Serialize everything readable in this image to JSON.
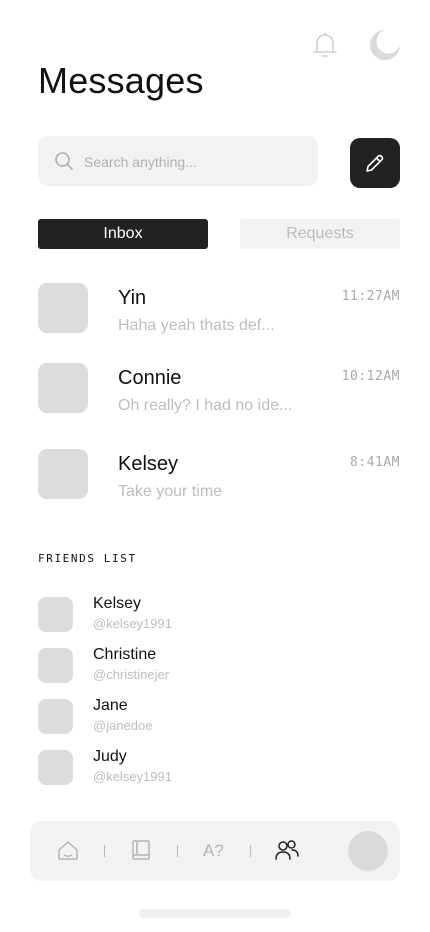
{
  "header": {
    "title": "Messages",
    "icons": [
      "bell-icon",
      "moon-icon"
    ]
  },
  "search": {
    "placeholder": "Search anything...",
    "value": ""
  },
  "tabs": [
    {
      "label": "Inbox",
      "active": true
    },
    {
      "label": "Requests",
      "active": false
    }
  ],
  "conversations": [
    {
      "name": "Yin",
      "preview": "Haha yeah thats def...",
      "time": "11:27AM"
    },
    {
      "name": "Connie",
      "preview": "Oh really? I had no ide...",
      "time": "10:12AM"
    },
    {
      "name": "Kelsey",
      "preview": "Take your time",
      "time": "8:41AM"
    }
  ],
  "friends": {
    "heading": "FRIENDS LIST",
    "items": [
      {
        "name": "Kelsey",
        "handle": "@kelsey1991"
      },
      {
        "name": "Christine",
        "handle": "@christinejer"
      },
      {
        "name": "Jane",
        "handle": "@janedoe"
      },
      {
        "name": "Judy",
        "handle": "@kelsey1991"
      }
    ]
  },
  "bottom_nav": {
    "items": [
      "home-icon",
      "book-icon",
      "translate-icon",
      "friends-icon",
      "profile-avatar"
    ],
    "translate_label": "A?",
    "active": "friends-icon"
  },
  "colors": {
    "accent_dark": "#222222",
    "surface": "#f2f2f2",
    "muted_text": "#bdbdbd",
    "avatar_placeholder": "#dcdcdc"
  }
}
